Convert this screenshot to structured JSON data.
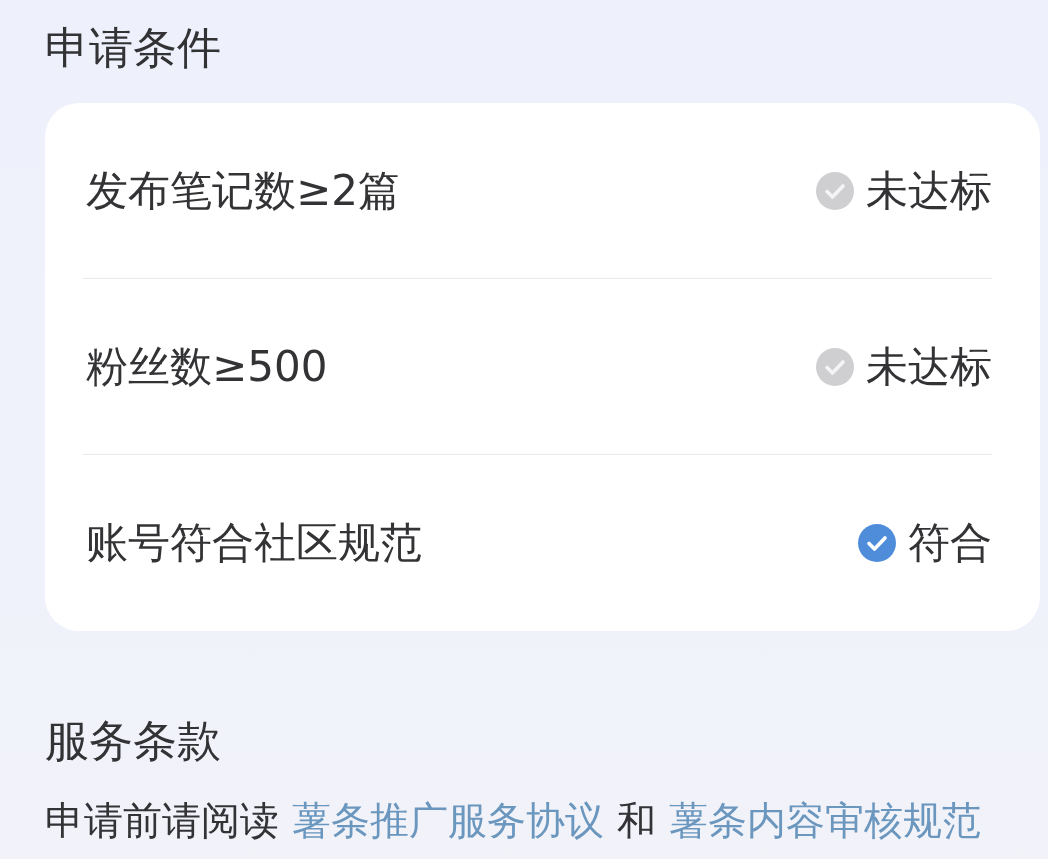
{
  "section_title": "申请条件",
  "conditions": [
    {
      "label": "发布笔记数≥2篇",
      "status": "未达标",
      "met": false
    },
    {
      "label": "粉丝数≥500",
      "status": "未达标",
      "met": false
    },
    {
      "label": "账号符合社区规范",
      "status": "符合",
      "met": true
    }
  ],
  "terms": {
    "title": "服务条款",
    "parts": [
      {
        "kind": "text",
        "text": "申请前请阅读"
      },
      {
        "kind": "link",
        "text": "薯条推广服务协议"
      },
      {
        "kind": "text",
        "text": "和"
      },
      {
        "kind": "link",
        "text": "薯条内容审核规范"
      }
    ]
  }
}
